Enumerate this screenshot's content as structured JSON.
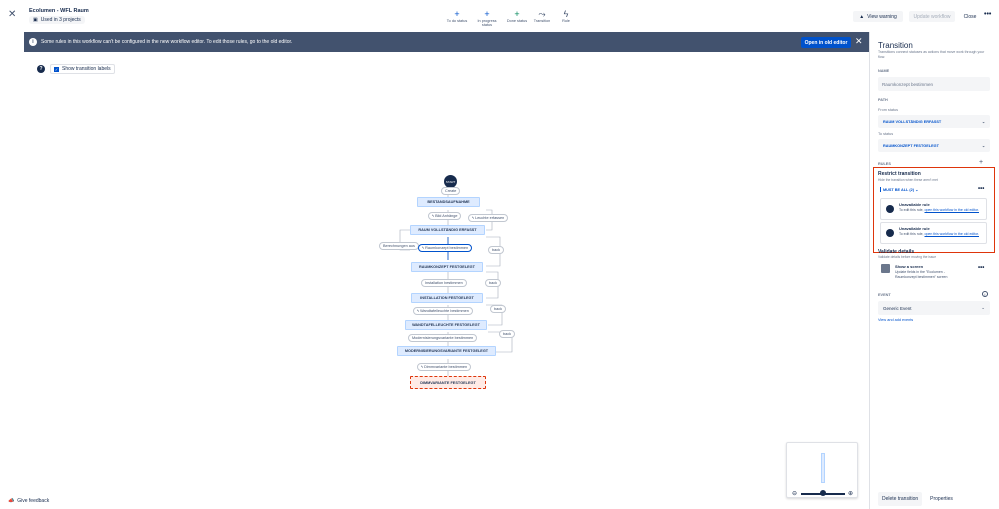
{
  "header": {
    "workflow_name": "Ecolumen - WFL Raum",
    "used_in": "Used in 3 projects",
    "tools": [
      {
        "label": "To do status",
        "icon": "plus-icon"
      },
      {
        "label": "In progress status",
        "icon": "plus-icon"
      },
      {
        "label": "Done status",
        "icon": "plus-icon"
      },
      {
        "label": "Transition",
        "icon": "transition-icon"
      },
      {
        "label": "Rule",
        "icon": "lightning-icon"
      }
    ],
    "view_warning": "View warning",
    "update_workflow": "Update workflow",
    "close": "Close"
  },
  "banner": {
    "message": "Some rules in this workflow can't be configured in the new workflow editor. To edit those rules, go to the old editor.",
    "open_old_editor": "Open in old editor"
  },
  "canvas": {
    "show_transition_labels": "Show transition labels",
    "start_label": "START",
    "create_label": "Create",
    "statuses": [
      "BESTANDSAUFNAHME",
      "RAUM VOLLSTÄNDIG ERFASST",
      "RAUMKONZEPT FESTGELEGT",
      "INSTALLATION FESTGELEGT",
      "WANDTAFELLEUCHTE FESTGELEGT",
      "MODERNISIERUNGSVARIANTE FESTGELEGT",
      "DIMMVARIANTE FESTGELEGT"
    ],
    "transitions": [
      "Bild Anhänge",
      "Leuchte erfassen",
      "Berechnungen aus",
      "Raumkonzept bestimmen",
      "Installation bestimmen",
      "Wandtafelleuchte bestimmen",
      "Modernisierungsvariante bestimmen",
      "Dimmvariante bestimmen"
    ],
    "back_label": "back",
    "give_feedback": "Give feedback"
  },
  "panel": {
    "title": "Transition",
    "subtitle": "Transitions connect statuses as actions that move work through your flow.",
    "name_label": "NAME",
    "name_value": "Raumkonzept bestimmen",
    "path_label": "PATH",
    "from_label": "From status",
    "from_value": "RAUM VOLLSTÄNDIG ERFASST",
    "to_label": "To status",
    "to_value": "RAUMKONZEPT FESTGELEGT",
    "rules_label": "RULES",
    "restrict_title": "Restrict transition",
    "restrict_sub": "Hide the transition when these aren't met",
    "must_be_all": "MUST BE ALL (2)",
    "rule_title": "Unavailable rule",
    "rule_desc_prefix": "To edit this rule,",
    "rule_desc_link": "open this workflow in the old editor.",
    "validate_title": "Validate details",
    "validate_sub": "Validate details before moving the issue",
    "screen_title": "Show a screen",
    "screen_desc": "Update fields in the \"Ecolumen - Raumkonzept bestimmen\" screen",
    "event_label": "EVENT",
    "event_value": "Generic Event",
    "event_link": "View and add events",
    "delete_transition": "Delete transition",
    "properties": "Properties"
  }
}
